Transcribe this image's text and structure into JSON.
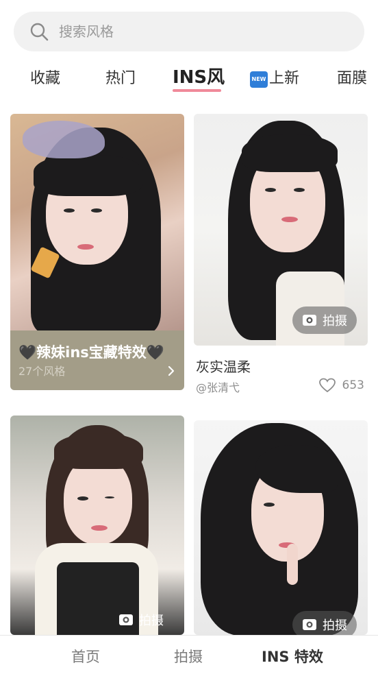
{
  "search": {
    "placeholder": "搜索风格"
  },
  "tabs": [
    {
      "label": "收藏"
    },
    {
      "label": "热门"
    },
    {
      "label": "INS风"
    },
    {
      "label": "上新",
      "badge": "NEW"
    },
    {
      "label": "面膜"
    }
  ],
  "active_tab": "INS风",
  "cards": {
    "collection": {
      "title": "🖤辣妹ins宝藏特效🖤",
      "count": "27个风格"
    },
    "item1": {
      "badge": "拍摄",
      "title": "灰实温柔",
      "author": "@张清弋",
      "likes": "653"
    },
    "item2": {
      "badge": "拍摄"
    },
    "item3": {
      "badge": "拍摄"
    }
  },
  "bottom_nav": [
    {
      "label": "首页"
    },
    {
      "label": "拍摄"
    },
    {
      "label": "INS 特效"
    }
  ],
  "active_nav": "INS 特效",
  "colors": {
    "accent_underline": "#f08a9a",
    "collection_band": "#a39d88",
    "new_badge": "#2f7ed8"
  },
  "icons": [
    "search-icon",
    "camera-icon",
    "chevron-right-icon",
    "heart-icon"
  ]
}
